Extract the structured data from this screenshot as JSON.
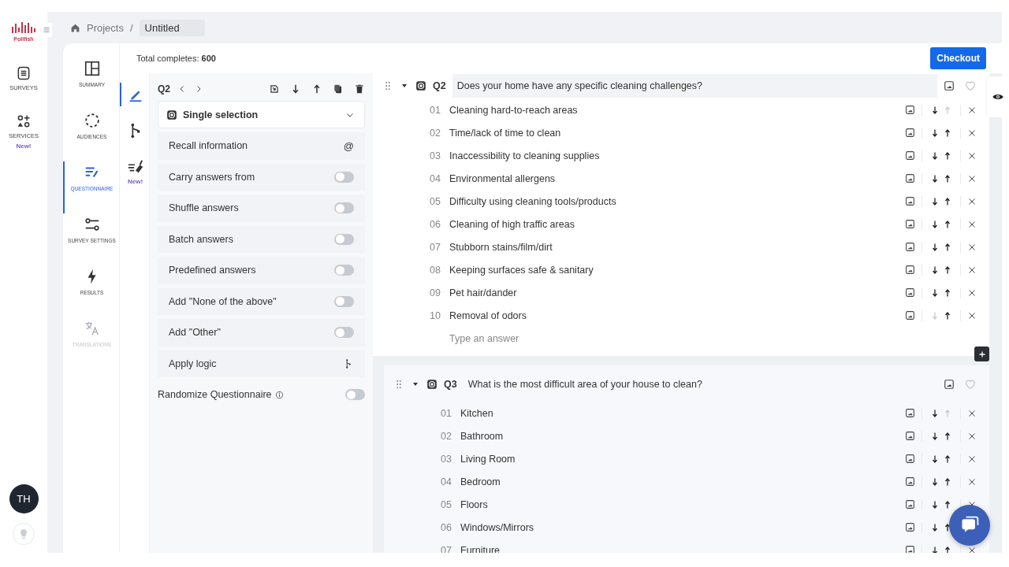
{
  "brand": {
    "name": "Pollfish"
  },
  "rail": [
    {
      "label": "SURVEYS"
    },
    {
      "label": "SERVICES",
      "badge": "New!"
    }
  ],
  "avatar": {
    "initials": "TH"
  },
  "breadcrumb": {
    "root": "Projects",
    "separator": "/",
    "current": "Untitled"
  },
  "nav": [
    {
      "label": "SUMMARY",
      "selected": false,
      "disabled": false
    },
    {
      "label": "AUDIENCES",
      "selected": false,
      "disabled": false
    },
    {
      "label": "QUESTIONNAIRE",
      "selected": true,
      "disabled": false
    },
    {
      "label": "SURVEY SETTINGS",
      "selected": false,
      "disabled": false
    },
    {
      "label": "RESULTS",
      "selected": false,
      "disabled": false
    },
    {
      "label": "TRANSLATIONS",
      "selected": false,
      "disabled": true
    }
  ],
  "total_completes": {
    "label": "Total completes:",
    "value": "600"
  },
  "checkout": {
    "label": "Checkout"
  },
  "tools": [
    {
      "selected": true
    },
    {
      "selected": false
    },
    {
      "selected": false,
      "badge": "New!"
    }
  ],
  "editor": {
    "question": "Q2",
    "type": "Single selection",
    "options": [
      {
        "kind": "mention",
        "label": "Recall information",
        "symbol": "@"
      },
      {
        "kind": "toggle",
        "label": "Carry answers from",
        "on": false
      },
      {
        "kind": "toggle",
        "label": "Shuffle answers",
        "on": false
      },
      {
        "kind": "toggle",
        "label": "Batch answers",
        "on": false
      },
      {
        "kind": "toggle",
        "label": "Predefined answers",
        "on": false
      },
      {
        "kind": "toggle",
        "label": "Add \"None of the above\"",
        "on": false
      },
      {
        "kind": "toggle",
        "label": "Add \"Other\"",
        "on": false
      },
      {
        "kind": "logic",
        "label": "Apply logic"
      }
    ],
    "randomize": {
      "label": "Randomize Questionnaire",
      "on": false
    }
  },
  "questions": [
    {
      "number": "Q2",
      "text": "Does your home have any specific cleaning challenges?",
      "active": true,
      "expanded": true,
      "new_answer_placeholder": "Type an answer",
      "answers": [
        {
          "number": "01",
          "text": "Cleaning hard-to-reach areas",
          "can_move_down": true,
          "can_move_up": false
        },
        {
          "number": "02",
          "text": "Time/lack of time to clean",
          "can_move_down": true,
          "can_move_up": true
        },
        {
          "number": "03",
          "text": "Inaccessibility to cleaning supplies",
          "can_move_down": true,
          "can_move_up": true
        },
        {
          "number": "04",
          "text": "Environmental allergens",
          "can_move_down": true,
          "can_move_up": true
        },
        {
          "number": "05",
          "text": "Difficulty using cleaning tools/products",
          "can_move_down": true,
          "can_move_up": true
        },
        {
          "number": "06",
          "text": "Cleaning of high traffic areas",
          "can_move_down": true,
          "can_move_up": true
        },
        {
          "number": "07",
          "text": "Stubborn stains/film/dirt",
          "can_move_down": true,
          "can_move_up": true
        },
        {
          "number": "08",
          "text": "Keeping surfaces safe & sanitary",
          "can_move_down": true,
          "can_move_up": true
        },
        {
          "number": "09",
          "text": "Pet hair/dander",
          "can_move_down": true,
          "can_move_up": true
        },
        {
          "number": "10",
          "text": "Removal of odors",
          "can_move_down": false,
          "can_move_up": true
        }
      ]
    },
    {
      "number": "Q3",
      "text": "What is the most difficult area of your house to clean?",
      "active": false,
      "expanded": true,
      "answers": [
        {
          "number": "01",
          "text": "Kitchen",
          "can_move_down": true,
          "can_move_up": false
        },
        {
          "number": "02",
          "text": "Bathroom",
          "can_move_down": true,
          "can_move_up": true
        },
        {
          "number": "03",
          "text": "Living Room",
          "can_move_down": true,
          "can_move_up": true
        },
        {
          "number": "04",
          "text": "Bedroom",
          "can_move_down": true,
          "can_move_up": true
        },
        {
          "number": "05",
          "text": "Floors",
          "can_move_down": true,
          "can_move_up": true
        },
        {
          "number": "06",
          "text": "Windows/Mirrors",
          "can_move_down": true,
          "can_move_up": true
        },
        {
          "number": "07",
          "text": "Furniture",
          "can_move_down": true,
          "can_move_up": true
        }
      ]
    }
  ]
}
